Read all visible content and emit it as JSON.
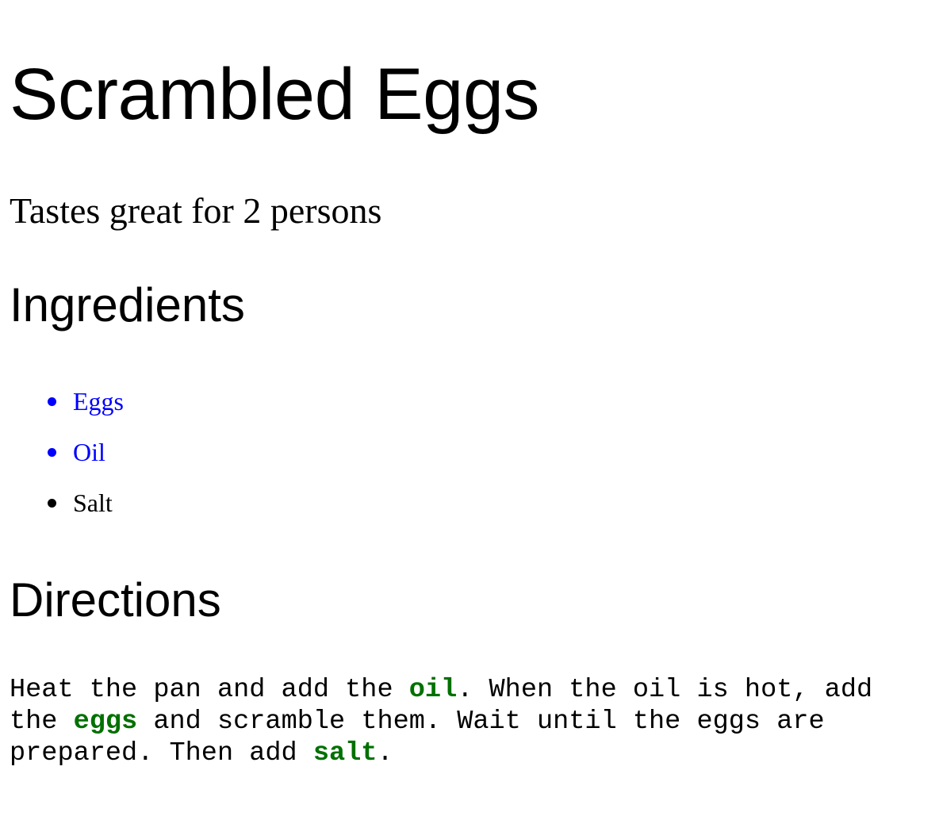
{
  "title": "Scrambled Eggs",
  "subtitle": "Tastes great for 2 persons",
  "ingredients_heading": "Ingredients",
  "ingredients": [
    {
      "label": "Eggs",
      "color": "#0000ff"
    },
    {
      "label": "Oil",
      "color": "#0000ff"
    },
    {
      "label": "Salt",
      "color": "#000000"
    }
  ],
  "directions_heading": "Directions",
  "directions": {
    "line1_a": "Heat the pan and add the ",
    "line1_oil": "oil",
    "line1_b": ". When the oil is hot, add",
    "line2_a": "the ",
    "line2_eggs": "eggs",
    "line2_b": " and scramble them. Wait until the eggs are",
    "line3_a": "prepared. Then add ",
    "line3_salt": "salt",
    "line3_b": ".",
    "highlight_color": "#007000"
  }
}
